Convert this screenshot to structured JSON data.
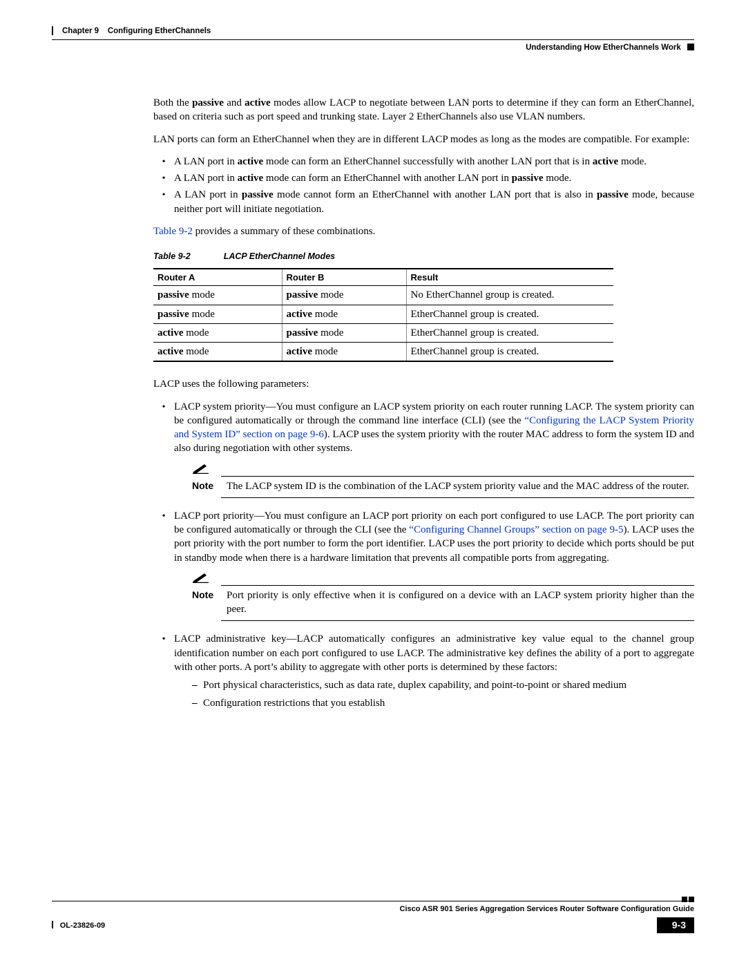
{
  "header": {
    "chapter_label": "Chapter 9",
    "chapter_title": "Configuring EtherChannels",
    "section_title": "Understanding How EtherChannels Work"
  },
  "body": {
    "para1_a": "Both the ",
    "para1_b": "passive",
    "para1_c": " and ",
    "para1_d": "active",
    "para1_e": " modes allow LACP to negotiate between LAN ports to determine if they can form an EtherChannel, based on criteria such as port speed and trunking state. Layer 2 EtherChannels also use VLAN numbers.",
    "para2": "LAN ports can form an EtherChannel when they are in different LACP modes as long as the modes are compatible. For example:",
    "bul": [
      {
        "a": "A LAN port in ",
        "b": "active",
        "c": " mode can form an EtherChannel successfully with another LAN port that is in ",
        "d": "active",
        "e": " mode."
      },
      {
        "a": "A LAN port in ",
        "b": "active",
        "c": " mode can form an EtherChannel with another LAN port in ",
        "d": "passive",
        "e": " mode."
      },
      {
        "a": "A LAN port in ",
        "b": "passive",
        "c": " mode cannot form an EtherChannel with another LAN port that is also in ",
        "d": "passive",
        "e": " mode, because neither port will initiate negotiation."
      }
    ],
    "table_ref_a": "Table 9-2",
    "table_ref_b": " provides a summary of these combinations.",
    "table_caption_num": "Table 9-2",
    "table_caption_title": "LACP EtherChannel Modes",
    "table": {
      "headers": [
        "Router A",
        "Router B",
        "Result"
      ],
      "rows": [
        {
          "a_bold": "passive",
          "a_rest": " mode",
          "b_bold": "passive",
          "b_rest": " mode",
          "res": "No EtherChannel group is created."
        },
        {
          "a_bold": "passive",
          "a_rest": " mode",
          "b_bold": "active",
          "b_rest": " mode",
          "res": "EtherChannel group is created."
        },
        {
          "a_bold": "active",
          "a_rest": " mode",
          "b_bold": "passive",
          "b_rest": " mode",
          "res": "EtherChannel group is created."
        },
        {
          "a_bold": "active",
          "a_rest": " mode",
          "b_bold": "active",
          "b_rest": " mode",
          "res": "EtherChannel group is created."
        }
      ]
    },
    "para_params": "LACP uses the following parameters:",
    "param1_a": "LACP system priority—You must configure an LACP system priority on each router running LACP. The system priority can be configured automatically or through the command line interface (CLI) (see the ",
    "param1_link": "“Configuring the LACP System Priority and System ID” section on page 9-6",
    "param1_b": "). LACP uses the system priority with the router MAC address to form the system ID and also during negotiation with other systems.",
    "note1_label": "Note",
    "note1_text": "The LACP system ID is the combination of the LACP system priority value and the MAC address of the router.",
    "param2_a": "LACP port priority—You must configure an LACP port priority on each port configured to use LACP. The port priority can be configured automatically or through the CLI (see the ",
    "param2_link": "“Configuring Channel Groups” section on page 9-5",
    "param2_b": "). LACP uses the port priority with the port number to form the port identifier. LACP uses the port priority to decide which ports should be put in standby mode when there is a hardware limitation that prevents all compatible ports from aggregating.",
    "note2_label": "Note",
    "note2_text": "Port priority is only effective when it is configured on a device with an LACP system priority higher than the peer.",
    "param3": "LACP administrative key—LACP automatically configures an administrative key value equal to the channel group identification number on each port configured to use LACP. The administrative key defines the ability of a port to aggregate with other ports. A port’s ability to aggregate with other ports is determined by these factors:",
    "sub": [
      "Port physical characteristics, such as data rate, duplex capability, and point-to-point or shared medium",
      "Configuration restrictions that you establish"
    ]
  },
  "footer": {
    "guide_title": "Cisco ASR 901 Series Aggregation Services Router Software Configuration Guide",
    "doc_id": "OL-23826-09",
    "page_num": "9-3"
  }
}
